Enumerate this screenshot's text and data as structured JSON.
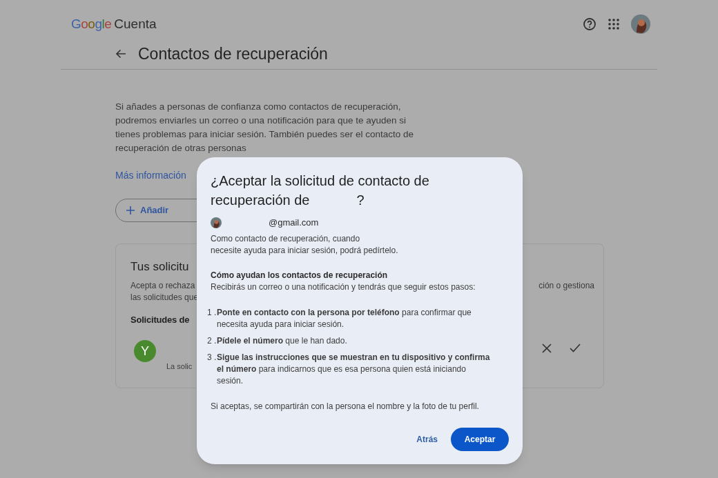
{
  "header": {
    "logo": "Google",
    "product": "Cuenta"
  },
  "page": {
    "title": "Contactos de recuperación",
    "intro": "Si añades a personas de confianza como contactos de recuperación, podremos enviarles un correo o una notificación para que te ayuden si tienes problemas para iniciar sesión. También puedes ser el contacto de recuperación de otras personas",
    "link": "Más información",
    "add_button": "Añadir"
  },
  "requests_card": {
    "title": "Tus solicitu",
    "desc_left_1": "Acepta o rechaza",
    "desc_left_2": "las solicitudes que",
    "desc_right": "ción o gestiona",
    "subtitle": "Solicitudes de",
    "request": {
      "avatar_letter": "Y",
      "text": "La solic"
    }
  },
  "dialog": {
    "title_start": "¿Aceptar la solicitud de contacto de recuperación de",
    "title_end": "?",
    "email": "@gmail.com",
    "intro_1": "Como contacto de recuperación, cuando",
    "intro_2": "necesite ayuda para iniciar sesión, podrá pedírtelo.",
    "section_title": "Cómo ayudan los contactos de recuperación",
    "section_text": "Recibirás un correo o una notificación y tendrás que seguir estos pasos:",
    "steps": [
      {
        "number": "1 .",
        "text": "**Ponte en contacto con la persona por teléfono** para confirmar que necesita ayuda para iniciar sesión."
      },
      {
        "number": "2 .",
        "text": "**Pídele el número** que le han dado."
      },
      {
        "number": "3 .",
        "text": "**Sigue las instrucciones que se muestran en tu dispositivo y confirma el número** para indicarnos que es esa persona quien está iniciando sesión."
      }
    ],
    "note": "Si aceptas, se compartirán con la persona el nombre y la foto de tu perfil.",
    "back_button": "Atrás",
    "accept_button": "Aceptar"
  }
}
